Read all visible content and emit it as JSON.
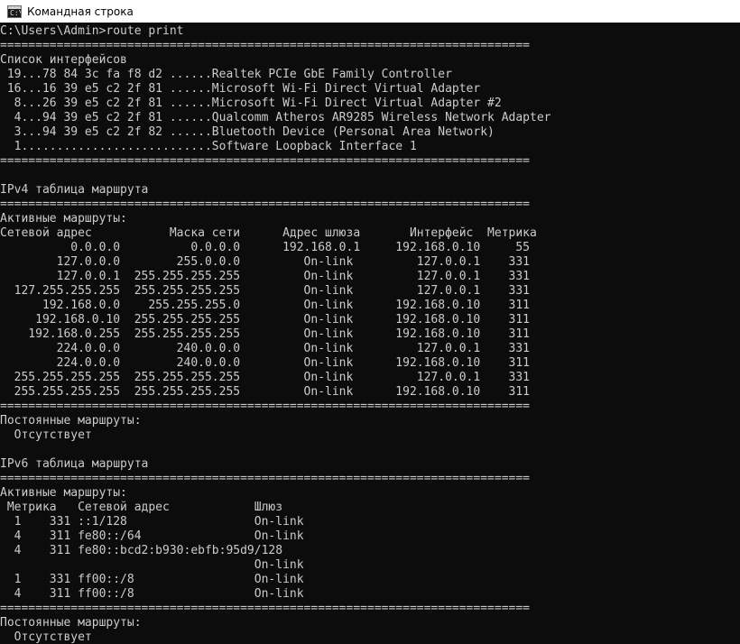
{
  "window": {
    "title": "Командная строка"
  },
  "console": {
    "lines": [
      "C:\\Users\\Admin>route print",
      "===========================================================================",
      "Список интерфейсов",
      " 19...78 84 3c fa f8 d2 ......Realtek PCIe GbE Family Controller",
      " 16...16 39 e5 c2 2f 81 ......Microsoft Wi-Fi Direct Virtual Adapter",
      "  8...26 39 e5 c2 2f 81 ......Microsoft Wi-Fi Direct Virtual Adapter #2",
      "  4...94 39 e5 c2 2f 81 ......Qualcomm Atheros AR9285 Wireless Network Adapter",
      "  3...94 39 e5 c2 2f 82 ......Bluetooth Device (Personal Area Network)",
      "  1...........................Software Loopback Interface 1",
      "===========================================================================",
      "",
      "IPv4 таблица маршрута",
      "===========================================================================",
      "Активные маршруты:",
      "Сетевой адрес           Маска сети      Адрес шлюза       Интерфейс  Метрика",
      "          0.0.0.0          0.0.0.0      192.168.0.1     192.168.0.10     55",
      "        127.0.0.0        255.0.0.0         On-link         127.0.0.1    331",
      "        127.0.0.1  255.255.255.255         On-link         127.0.0.1    331",
      "  127.255.255.255  255.255.255.255         On-link         127.0.0.1    331",
      "      192.168.0.0    255.255.255.0         On-link      192.168.0.10    311",
      "     192.168.0.10  255.255.255.255         On-link      192.168.0.10    311",
      "    192.168.0.255  255.255.255.255         On-link      192.168.0.10    311",
      "        224.0.0.0        240.0.0.0         On-link         127.0.0.1    331",
      "        224.0.0.0        240.0.0.0         On-link      192.168.0.10    311",
      "  255.255.255.255  255.255.255.255         On-link         127.0.0.1    331",
      "  255.255.255.255  255.255.255.255         On-link      192.168.0.10    311",
      "===========================================================================",
      "Постоянные маршруты:",
      "  Отсутствует",
      "",
      "IPv6 таблица маршрута",
      "===========================================================================",
      "Активные маршруты:",
      " Метрика   Сетевой адрес            Шлюз",
      "  1    331 ::1/128                  On-link",
      "  4    311 fe80::/64                On-link",
      "  4    311 fe80::bcd2:b930:ebfb:95d9/128",
      "                                    On-link",
      "  1    331 ff00::/8                 On-link",
      "  4    311 ff00::/8                 On-link",
      "===========================================================================",
      "Постоянные маршруты:",
      "  Отсутствует"
    ]
  }
}
